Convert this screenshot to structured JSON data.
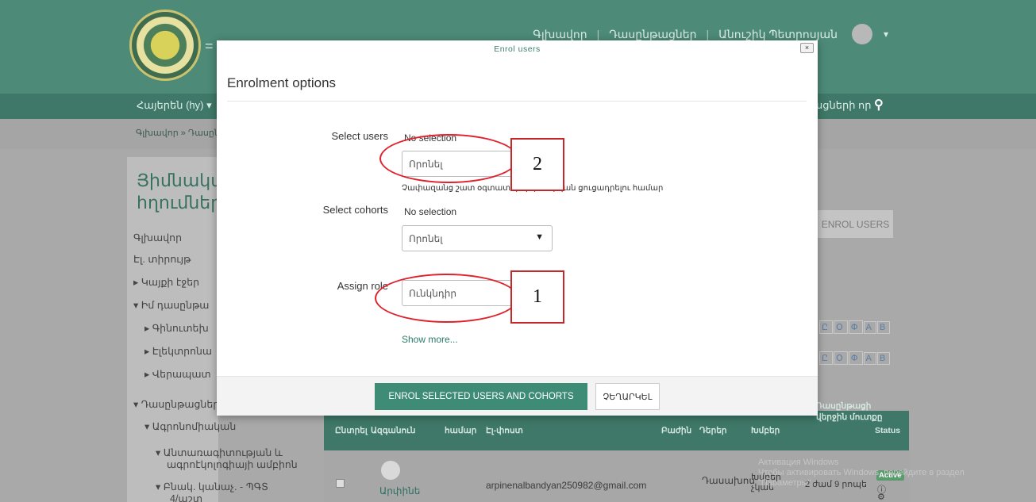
{
  "background": {
    "top_nav": [
      "Գլխավոր",
      "Դասընթացներ",
      "Անուշիկ Պետրոսյան"
    ],
    "brand_fragment": "=",
    "language": "Հայերեն (hy) ▾",
    "nav_right": "սցների որ",
    "breadcrumb": "Գլխավոր » Դասըն",
    "left_heading": "Յիմնակա\nհղումներ",
    "left_nav": [
      "Գլխավոր",
      "Էլ. տիրույթ",
      "▸ Կայքի էջեր",
      "▾ Իմ դասընթա",
      "▸ Գինուտեխ",
      "▸ Էլեկտրոնա",
      "▸ Վերապատ",
      "▾ Դասընթացներ",
      "▾ Ագրոնոմիական",
      "▾ Անտառագիտության և",
      "ագրոէկոլոգիայի ամբիոն",
      "▾ Բնակ. կանաչ. - ՊԳՏ",
      "4/աշտ"
    ],
    "enrol_users_button": "ENROL USERS",
    "letter_filters": [
      "Ը",
      "Օ",
      "Փ",
      "A",
      "B"
    ],
    "table": {
      "headers": [
        "Ընտրել",
        "Ազգանուն",
        "համար",
        "Էլ-փոստ",
        "Բաժին",
        "Դերեր",
        "Խմբեր",
        "Status"
      ],
      "last_access_header": "Դասընթացի վերջին մուտքը",
      "row": {
        "name": "Արփինե",
        "email": "arpinenalbandyan250982@gmail.com",
        "role": "Դասախոս",
        "group": "Խմբեր չկան",
        "last_access": "2 ժամ 9 րոպե",
        "status": "Active"
      }
    },
    "windows_watermark": "Активация Windows\nЧтобы активировать Windows, перейдите в раздел \"Параметры\"."
  },
  "modal": {
    "title": "Enrol users",
    "close_label": "×",
    "heading": "Enrolment options",
    "select_users": {
      "label": "Select users",
      "selection": "No selection",
      "placeholder": "Որոնել",
      "hint": "Չափազանց շատ օգտատերեր (>100) կան ցուցադրելու համար"
    },
    "select_cohorts": {
      "label": "Select cohorts",
      "selection": "No selection",
      "placeholder": "Որոնել"
    },
    "assign_role": {
      "label": "Assign role",
      "value": "Ունկնդիր"
    },
    "show_more": "Show more...",
    "primary_button": "ENROL SELECTED USERS AND COHORTS",
    "cancel_button": "ՉԵՂԱՐԿԵԼ"
  },
  "annotations": [
    "2",
    "1"
  ],
  "colors": {
    "brand": "#4d8a78",
    "accent": "#3e8b76",
    "annotation": "#e0202a"
  }
}
